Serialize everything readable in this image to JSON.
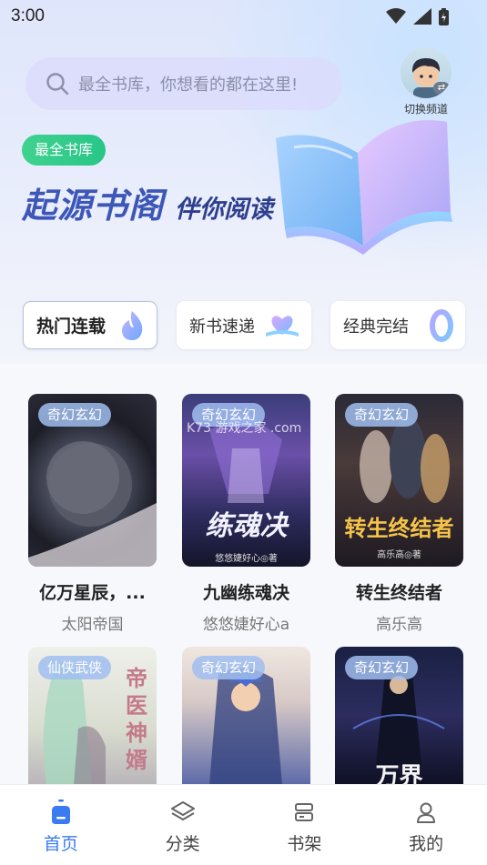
{
  "status_bar": {
    "time": "3:00"
  },
  "search": {
    "placeholder": "最全书库，你想看的都在这里!"
  },
  "channel_switch": {
    "label": "切换频道"
  },
  "hero": {
    "badge": "最全书库",
    "title": "起源书阁",
    "subtitle": "伴你阅读"
  },
  "quick_tabs": [
    {
      "label": "热门连载",
      "active": true
    },
    {
      "label": "新书速递",
      "active": false
    },
    {
      "label": "经典完结",
      "active": false
    }
  ],
  "books": [
    {
      "tag": "奇幻玄幻",
      "title": "亿万星辰，...",
      "author": "太阳帝国",
      "cover_text": ""
    },
    {
      "tag": "奇幻玄幻",
      "title": "九幽练魂决",
      "author": "悠悠婕好心a",
      "cover_text": "练魂决",
      "cover_small": "悠悠婕好心◎著"
    },
    {
      "tag": "奇幻玄幻",
      "title": "转生终结者",
      "author": "高乐高",
      "cover_text": "转生终结者",
      "cover_small": "高乐高◎著"
    },
    {
      "tag": "仙侠武侠",
      "title": "",
      "author": "",
      "cover_text": "帝医神婿"
    },
    {
      "tag": "奇幻玄幻",
      "title": "",
      "author": "",
      "cover_text": ""
    },
    {
      "tag": "奇幻玄幻",
      "title": "",
      "author": "",
      "cover_text": "万界"
    }
  ],
  "watermark": "K73 游戏之家 .com",
  "tabbar": [
    {
      "label": "首页",
      "icon": "home-icon",
      "active": true
    },
    {
      "label": "分类",
      "icon": "layers-icon",
      "active": false
    },
    {
      "label": "书架",
      "icon": "bookshelf-icon",
      "active": false
    },
    {
      "label": "我的",
      "icon": "user-icon",
      "active": false
    }
  ],
  "colors": {
    "accent": "#3a7bf1",
    "badge_green": "#2fcb8b",
    "hero_title": "#3d57b8"
  }
}
